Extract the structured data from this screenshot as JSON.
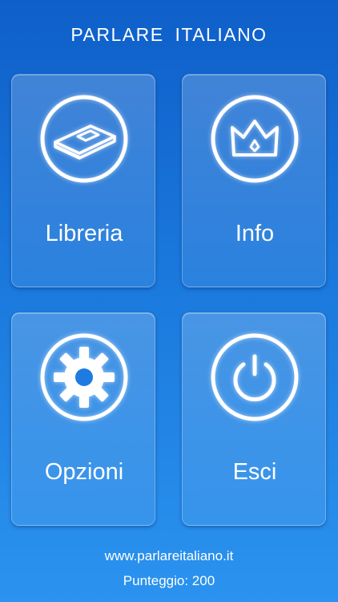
{
  "app": {
    "title": "PARLARE ITALIANO"
  },
  "menu": {
    "items": [
      {
        "id": "libreria",
        "label": "Libreria",
        "icon": "book-icon"
      },
      {
        "id": "info",
        "label": "Info",
        "icon": "crown-icon"
      },
      {
        "id": "opzioni",
        "label": "Opzioni",
        "icon": "gear-icon"
      },
      {
        "id": "esci",
        "label": "Esci",
        "icon": "power-icon"
      }
    ]
  },
  "footer": {
    "website": "www.parlareitaliano.it",
    "score": "Punteggio: 200"
  },
  "colors": {
    "background_top": "#0f5fc9",
    "background_bottom": "#2b93ef",
    "foreground": "#ffffff"
  }
}
